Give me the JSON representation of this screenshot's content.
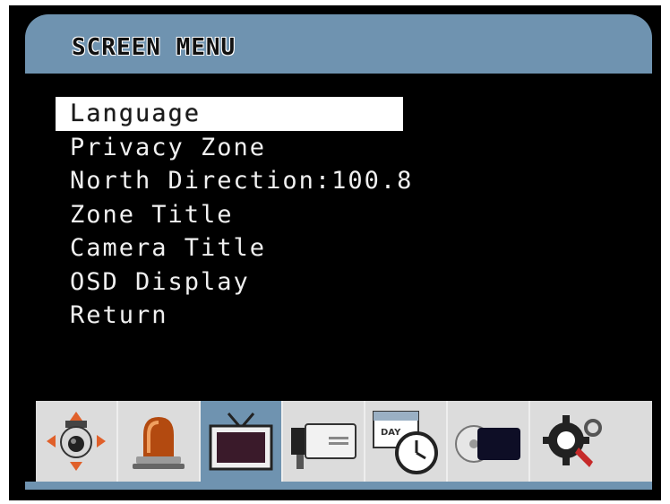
{
  "header": {
    "title": "SCREEN MENU"
  },
  "menu": {
    "items": [
      {
        "label": "Language",
        "selected": true
      },
      {
        "label": "Privacy Zone"
      },
      {
        "label": "North Direction:100.8"
      },
      {
        "label": "Zone Title"
      },
      {
        "label": "Camera Title"
      },
      {
        "label": "OSD Display"
      },
      {
        "label": "Return"
      }
    ]
  },
  "toolbar": {
    "icons": [
      {
        "name": "ptz-camera-icon"
      },
      {
        "name": "alarm-siren-icon"
      },
      {
        "name": "screen-tv-icon",
        "active": true
      },
      {
        "name": "camera-icon"
      },
      {
        "name": "day-clock-icon",
        "text": "DAY"
      },
      {
        "name": "disk-drive-icon"
      },
      {
        "name": "settings-gear-icon"
      }
    ]
  },
  "colors": {
    "accent": "#6f93b0",
    "background": "#000000",
    "selection": "#ffffff",
    "text": "#f0f0f0"
  }
}
